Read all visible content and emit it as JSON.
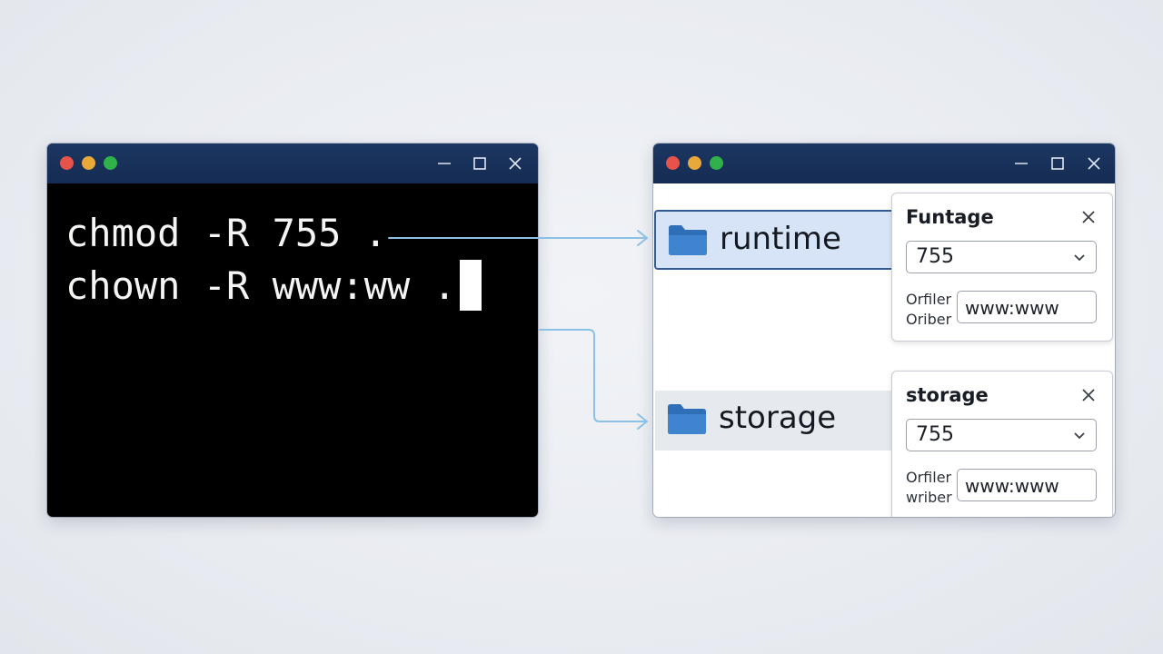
{
  "terminal": {
    "lines": [
      "chmod -R 755 .",
      "chown -R www:ww ."
    ]
  },
  "explorer": {
    "folders": [
      {
        "name": "runtime"
      },
      {
        "name": "storage"
      }
    ],
    "panels": [
      {
        "title": "Funtage",
        "mode": "755",
        "field_label_1": "Orfiler",
        "field_label_2": "Oriber",
        "owner": "www:www"
      },
      {
        "title": "storage",
        "mode": "755",
        "field_label_1": "Orfiler",
        "field_label_2": "wriber",
        "owner": "www:www"
      }
    ]
  },
  "colors": {
    "titlebar": "#1c3763",
    "connector": "#8cc0e6",
    "folder": "#2f6fb8",
    "selected_bg": "#d7e4f7"
  },
  "icons": [
    "folder-icon",
    "close-icon",
    "minimize-icon",
    "maximize-icon",
    "chevron-down-icon"
  ]
}
